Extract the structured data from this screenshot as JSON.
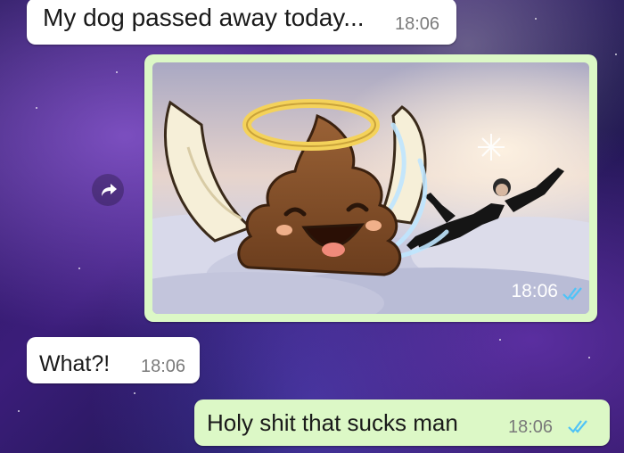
{
  "chat": {
    "messages": [
      {
        "direction": "incoming",
        "type": "text",
        "text": "My dog passed away today...",
        "time": "18:06"
      },
      {
        "direction": "outgoing",
        "type": "image",
        "image_alt": "angel poop emoji with halo and wings flying past a person skydiving above clouds",
        "time": "18:06",
        "status": "read"
      },
      {
        "direction": "incoming",
        "type": "text",
        "text": "What?!",
        "time": "18:06"
      },
      {
        "direction": "outgoing",
        "type": "text",
        "text": "Holy shit that sucks man",
        "time": "18:06",
        "status": "read"
      }
    ]
  },
  "colors": {
    "incoming_bubble": "#ffffff",
    "outgoing_bubble": "#dcf8c6",
    "read_ticks": "#4fc3f7"
  },
  "icons": {
    "forward": "forward-arrow-icon",
    "read_receipt": "double-check-icon"
  }
}
